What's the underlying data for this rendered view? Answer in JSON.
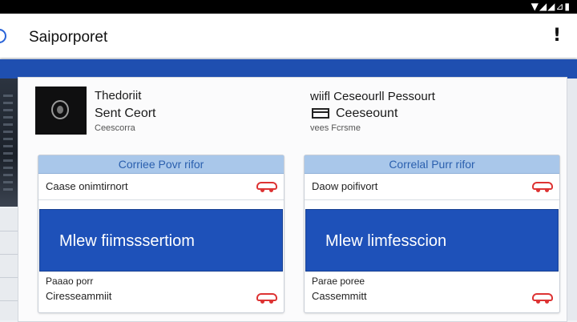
{
  "status_bar": {
    "icons": "▼◢◢⊿▮"
  },
  "app_bar": {
    "title": "Saiporporet",
    "menu": "!"
  },
  "profile": {
    "name_line1": "Thedoriit",
    "name_line2": "Sent Ceort",
    "subtitle": "Ceescorra"
  },
  "passport": {
    "label": "wiifl Ceseourll Pessourt",
    "value": "Ceeseount",
    "subtitle": "vees Fcrsme"
  },
  "panels": [
    {
      "header": "Corriee Povr rifor",
      "row_label": "Caase onimtirnort",
      "tile_label": "Mlew fiimsssertiom",
      "footer_line1": "Paaao porr",
      "footer_line2": "Ciresseammiit"
    },
    {
      "header": "Correlal Purr rifor",
      "row_label": "Daow poifivort",
      "tile_label": "Mlew limfesscion",
      "footer_line1": "Parae poree",
      "footer_line2": "Cassemmitt"
    }
  ],
  "colors": {
    "accent": "#1e51b9",
    "header_tint": "#a9c7ea",
    "alert_icon": "#dd3333"
  }
}
